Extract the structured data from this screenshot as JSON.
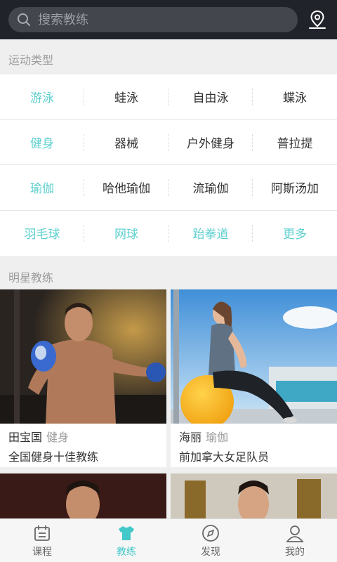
{
  "header": {
    "search_placeholder": "搜索教练",
    "search_icon": "search-icon",
    "location_icon": "location-pin-icon"
  },
  "sections": {
    "sport_types": "运动类型",
    "star_coaches": "明星教练"
  },
  "categories": [
    [
      {
        "label": "游泳",
        "accent": true
      },
      {
        "label": "蛙泳"
      },
      {
        "label": "自由泳"
      },
      {
        "label": "蝶泳"
      }
    ],
    [
      {
        "label": "健身",
        "accent": true
      },
      {
        "label": "器械"
      },
      {
        "label": "户外健身"
      },
      {
        "label": "普拉提"
      }
    ],
    [
      {
        "label": "瑜伽",
        "accent": true
      },
      {
        "label": "哈他瑜伽"
      },
      {
        "label": "流瑜伽"
      },
      {
        "label": "阿斯汤加"
      }
    ],
    [
      {
        "label": "羽毛球",
        "accent": true
      },
      {
        "label": "网球",
        "accent": true
      },
      {
        "label": "跆拳道",
        "accent": true
      },
      {
        "label": "更多",
        "accent": true
      }
    ]
  ],
  "coaches": [
    {
      "name": "田宝国",
      "tag": "健身",
      "desc": "全国健身十佳教练"
    },
    {
      "name": "海丽",
      "tag": "瑜伽",
      "desc": "前加拿大女足队员"
    }
  ],
  "tabs": [
    {
      "label": "课程",
      "icon": "calendar-icon"
    },
    {
      "label": "教练",
      "icon": "muscle-shirt-icon",
      "active": true
    },
    {
      "label": "发现",
      "icon": "compass-icon"
    },
    {
      "label": "我的",
      "icon": "user-icon"
    }
  ],
  "colors": {
    "accent": "#5ecfcf",
    "topbar": "#21232a"
  }
}
